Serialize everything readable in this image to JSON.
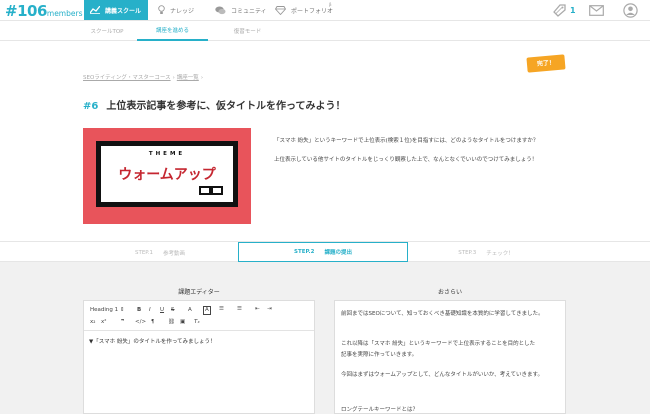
{
  "header": {
    "logo_main": "#106",
    "logo_sub": "members",
    "nav": [
      {
        "label": "講義スクール",
        "icon": "chart-icon"
      },
      {
        "label": "ナレッジ",
        "icon": "bulb-icon"
      },
      {
        "label": "コミュニティ",
        "icon": "chat-icon"
      },
      {
        "label": "ポートフォリオ",
        "icon": "diamond-icon"
      }
    ],
    "beta": "β",
    "notification_count": "1"
  },
  "subnav": {
    "tabs": [
      {
        "label": "スクールTOP"
      },
      {
        "label": "講座を進める"
      },
      {
        "label": "復習モード"
      }
    ]
  },
  "lesson": {
    "badge": "完了！",
    "breadcrumb": [
      "SEOライティング・マスターコース",
      "講座一覧"
    ],
    "number": "#6",
    "title": "上位表示記事を参考に、仮タイトルを作ってみよう！",
    "thumb_theme": "THEME",
    "thumb_title": "ウォームアップ",
    "desc1": "「スマホ 紛失」というキーワードで上位表示(検索１位)を目指すには、どのようなタイトルをつけますか？",
    "desc2": "上位表示している他サイトのタイトルをじっくり観察した上で、なんとなくでいいのでつけてみましょう！"
  },
  "steps": [
    {
      "num": "STEP.1",
      "label": "参考動画"
    },
    {
      "num": "STEP.2",
      "label": "課題の提出"
    },
    {
      "num": "STEP.3",
      "label": "チェック！"
    }
  ],
  "editor": {
    "heading": "課題エディター",
    "format_select": "Heading 1",
    "content": "▼「スマホ 紛失」のタイトルを作ってみましょう！"
  },
  "aim": {
    "heading": "おさらい",
    "lines": [
      "前回まではSEOについて、知っておくべき基礎知識を本質的に学習してきました。",
      "これ以降は「スマホ 紛失」というキーワードで上位表示することを目的とした",
      "記事を実際に作っていきます。",
      "今回はまずはウォームアップとして、どんなタイトルがいいか、考えていきます。",
      "ロングテールキーワードとは？"
    ]
  },
  "colors": {
    "accent": "#27b0c9",
    "badge": "#f6a524",
    "thumb_bg": "#e8545b",
    "thumb_title": "#c52630"
  }
}
